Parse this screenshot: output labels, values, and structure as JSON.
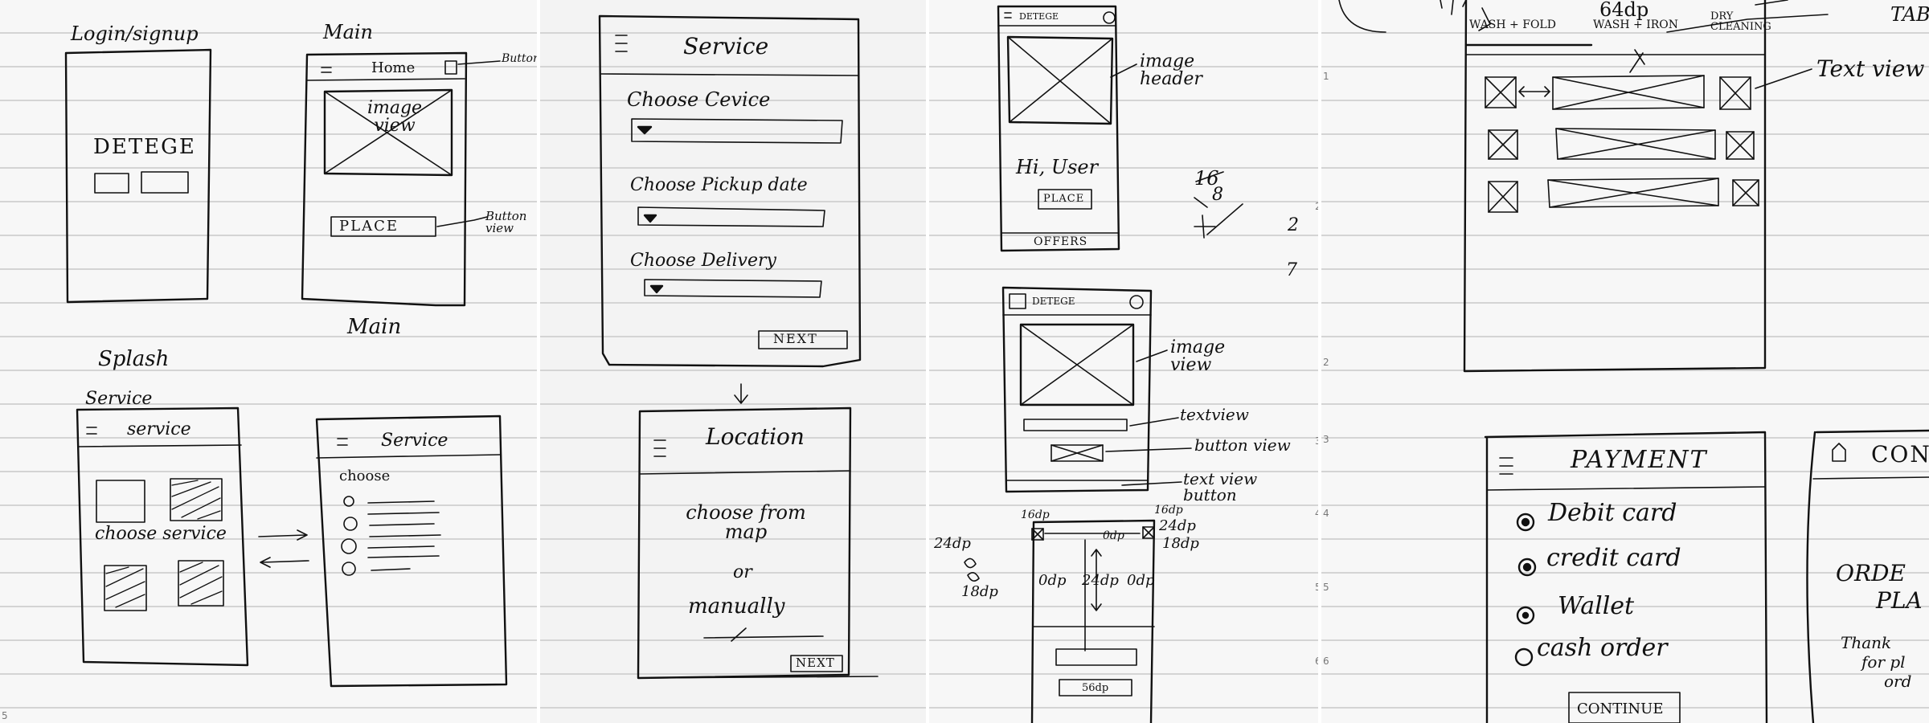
{
  "page1": {
    "login_title": "Login/signup",
    "main_title": "Main",
    "home_label": "Home",
    "button_annotation": "Button",
    "image_view_label": "image view",
    "place_label": "PLACE",
    "button_view_annotation": "Button view",
    "detege_label": "DETEGE",
    "main_label_2": "Main",
    "splash_label": "Splash",
    "service_label": "Service",
    "service_header": "service",
    "choose_service_label": "choose service",
    "choose_label": "choose",
    "service_header_2": "Service",
    "page_number": "5"
  },
  "page2": {
    "service_title": "Service",
    "choose_service": "Choose Cevice",
    "choose_pickup": "Choose Pickup date",
    "choose_delivery": "Choose Delivery",
    "next_label": "NEXT",
    "location_title": "Location",
    "choose_from_map": "choose from map",
    "or_label": "or",
    "manually_label": "manually",
    "next_label_2": "NEXT"
  },
  "page3": {
    "detege_small": "DETEGE",
    "image_header": "image header",
    "hi_user": "Hi, User",
    "place_small": "PLACE",
    "offers_label": "OFFERS",
    "detege_small_2": "DETEGE",
    "image_view": "image view",
    "textview": "textview",
    "button_view": "button view",
    "text_view_button": "text view button",
    "dim_16dp_left": "16dp",
    "dim_16dp_right": "16dp",
    "dim_24dp_left": "24dp",
    "dim_24dp_right": "24dp",
    "dim_18dp_a": "18dp",
    "dim_18dp_b": "18dp",
    "dim_0dp_top": "0dp",
    "dim_0dp_left": "0dp",
    "dim_0dp_right": "0dp",
    "dim_24dp_center": "24dp",
    "dim_56dp": "56dp",
    "calc_16": "16",
    "calc_8": "8",
    "calc_2": "2",
    "calc_7": "7",
    "margin_numbers": [
      "2",
      "3",
      "4",
      "5",
      "6"
    ]
  },
  "page4": {
    "dim_64dp": "64dp",
    "tab_wash_fold": "WASH + FOLD",
    "tab_wash_iron": "WASH + IRON",
    "tab_dry_cleaning": "DRY CLEANING",
    "tab_annotation": "TAB",
    "text_view_annotation": "Text view",
    "payment_title": "PAYMENT",
    "debit_card": "Debit card",
    "credit_card": "credit card",
    "wallet": "Wallet",
    "cash_order": "cash order",
    "continue_label": "CONTINUE",
    "confirm_title": "CON",
    "order_placed_1": "ORDE",
    "order_placed_2": "PLA",
    "thank_you_1": "Thank",
    "thank_you_2": "for pl",
    "thank_you_3": "ord",
    "margin_numbers": [
      "1",
      "2",
      "3",
      "4",
      "5",
      "6"
    ]
  }
}
